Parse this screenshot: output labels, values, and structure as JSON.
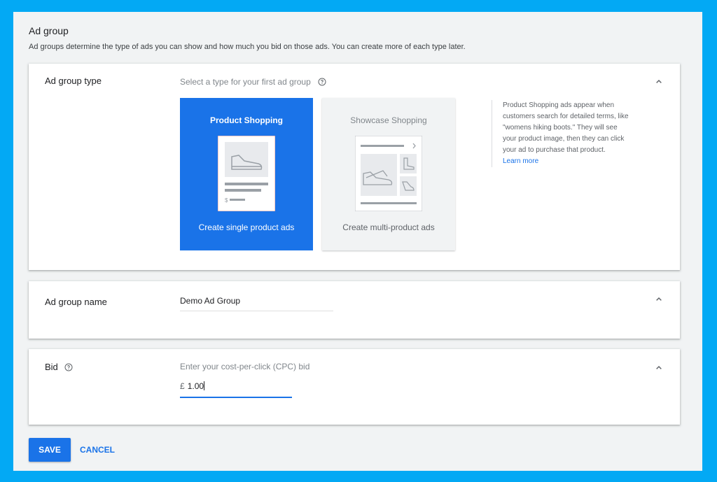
{
  "section": {
    "title": "Ad group",
    "subtitle": "Ad groups determine the type of ads you can show and how much you bid on those ads. You can create more of each type later."
  },
  "ad_group_type": {
    "label": "Ad group type",
    "hint": "Select a type for your first ad group",
    "tiles": [
      {
        "title": "Product Shopping",
        "caption": "Create single product ads",
        "selected": true,
        "price_glyph": "$"
      },
      {
        "title": "Showcase Shopping",
        "caption": "Create multi-product ads",
        "selected": false
      }
    ],
    "description": "Product Shopping ads appear when customers search for detailed terms, like \"womens hiking boots.\" They will see your product image, then they can click your ad to purchase that product.",
    "learn_more": "Learn more"
  },
  "ad_group_name": {
    "label": "Ad group name",
    "value": "Demo Ad Group"
  },
  "bid": {
    "label": "Bid",
    "hint": "Enter your cost-per-click (CPC) bid",
    "currency": "£",
    "value": "1.00"
  },
  "actions": {
    "save": "SAVE",
    "cancel": "CANCEL"
  },
  "colors": {
    "background": "#03a9f4",
    "accent": "#1a73e8"
  },
  "icons": [
    "help-icon",
    "chevron-up-icon",
    "shoe-icon",
    "boot-icon",
    "heel-icon"
  ]
}
